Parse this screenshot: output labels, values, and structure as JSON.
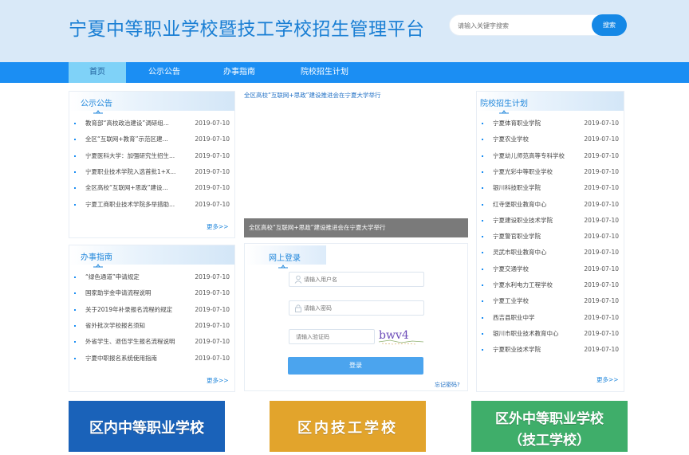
{
  "header": {
    "site_title": "宁夏中等职业学校暨技工学校招生管理平台",
    "search_placeholder": "请输入关键字搜索",
    "search_button": "搜索"
  },
  "nav": {
    "items": [
      "首页",
      "公示公告",
      "办事指南",
      "院校招生计划"
    ],
    "active": "首页"
  },
  "notices": {
    "title": "公示公告",
    "items": [
      {
        "title": "教育部“高校政治建设”调研组...",
        "date": "2019-07-10"
      },
      {
        "title": "全区“互联网+教育”示范区建...",
        "date": "2019-07-10"
      },
      {
        "title": "宁夏医科大学：加强研究生招生...",
        "date": "2019-07-10"
      },
      {
        "title": "宁夏职业技术学院入选首批1+X...",
        "date": "2019-07-10"
      },
      {
        "title": "全区高校“互联网+思政”建设...",
        "date": "2019-07-10"
      },
      {
        "title": "宁夏工商职业技术学院多举措助...",
        "date": "2019-07-10"
      }
    ],
    "more": "更多>>"
  },
  "guide": {
    "title": "办事指南",
    "items": [
      {
        "title": "“绿色通道”申请规定",
        "date": "2019-07-10"
      },
      {
        "title": "国家助学金申请流程说明",
        "date": "2019-07-10"
      },
      {
        "title": "关于2019年补录报名流程的规定",
        "date": "2019-07-10"
      },
      {
        "title": "省外批次学校报名须知",
        "date": "2019-07-10"
      },
      {
        "title": "外省学生、退伍学生报名流程说明",
        "date": "2019-07-10"
      },
      {
        "title": "宁夏中职报名系统使用指南",
        "date": "2019-07-10"
      }
    ],
    "more": "更多>>"
  },
  "banner": {
    "alt_text": "全区高校“互联网+思政”建设推进会在宁夏大学举行",
    "caption": "全区高校“互联网+思政”建设推进会在宁夏大学举行"
  },
  "login": {
    "title": "网上登录",
    "username_placeholder": "请输入用户名",
    "password_placeholder": "请输入密码",
    "captcha_placeholder": "请输入验证码",
    "captcha_text": "bwv4",
    "login_button": "登录",
    "forgot": "忘记密码?"
  },
  "plans": {
    "title": "院校招生计划",
    "items": [
      {
        "title": "宁夏体育职业学院",
        "date": "2019-07-10"
      },
      {
        "title": "宁夏农业学校",
        "date": "2019-07-10"
      },
      {
        "title": "宁夏幼儿师范高等专科学校",
        "date": "2019-07-10"
      },
      {
        "title": "宁夏光彩中等职业学校",
        "date": "2019-07-10"
      },
      {
        "title": "银川科技职业学院",
        "date": "2019-07-10"
      },
      {
        "title": "红寺堡职业教育中心",
        "date": "2019-07-10"
      },
      {
        "title": "宁夏建设职业技术学院",
        "date": "2019-07-10"
      },
      {
        "title": "宁夏警官职业学院",
        "date": "2019-07-10"
      },
      {
        "title": "灵武市职业教育中心",
        "date": "2019-07-10"
      },
      {
        "title": "宁夏交通学校",
        "date": "2019-07-10"
      },
      {
        "title": "宁夏水利电力工程学校",
        "date": "2019-07-10"
      },
      {
        "title": "宁夏工业学校",
        "date": "2019-07-10"
      },
      {
        "title": "西吉县职业中学",
        "date": "2019-07-10"
      },
      {
        "title": "银川市职业技术教育中心",
        "date": "2019-07-10"
      },
      {
        "title": "宁夏职业技术学院",
        "date": "2019-07-10"
      }
    ],
    "more": "更多>>"
  },
  "big_buttons": [
    {
      "line1": "区内中等职业学校",
      "line2": "",
      "color": "#1a62b9"
    },
    {
      "line1": "区内技工学校",
      "line2": "",
      "color": "#e2a42c"
    },
    {
      "line1": "区外中等职业学校",
      "line2": "（技工学校）",
      "color": "#3fae6a"
    }
  ],
  "colors": {
    "header_bg": "#d9e9f8",
    "nav_bg": "#1b8ef3",
    "nav_active_bg": "#7fd2f8",
    "accent": "#1f86db"
  }
}
